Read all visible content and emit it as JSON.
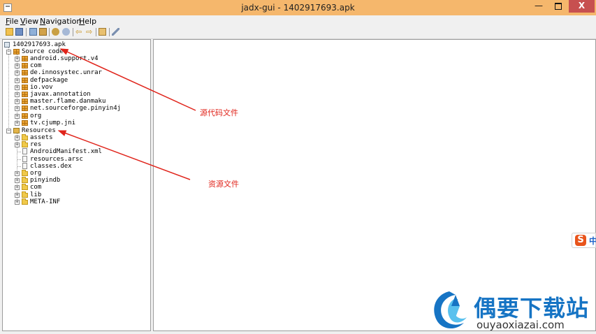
{
  "window": {
    "title": "jadx-gui - 1402917693.apk",
    "minimize_glyph": "—",
    "close_glyph": "X"
  },
  "menu": [
    "File",
    "View",
    "Navigation",
    "Help"
  ],
  "toolbar": {
    "icons": [
      "open-file-icon",
      "save-all-icon",
      "sync-tree-icon",
      "flatten-packages-icon",
      "search-text-icon",
      "search-class-icon",
      "back-icon",
      "forward-icon",
      "log-icon",
      "preferences-icon"
    ]
  },
  "tree": {
    "root": "1402917693.apk",
    "source_code": {
      "label": "Source code",
      "packages": [
        "android.support.v4",
        "com",
        "de.innosystec.unrar",
        "defpackage",
        "io.vov",
        "javax.annotation",
        "master.flame.danmaku",
        "net.sourceforge.pinyin4j",
        "org",
        "tv.cjump.jni"
      ]
    },
    "resources": {
      "label": "Resources",
      "items": [
        {
          "label": "assets",
          "type": "folder",
          "expandable": true
        },
        {
          "label": "res",
          "type": "folder",
          "expandable": true
        },
        {
          "label": "AndroidManifest.xml",
          "type": "file",
          "expandable": false
        },
        {
          "label": "resources.arsc",
          "type": "file",
          "expandable": false
        },
        {
          "label": "classes.dex",
          "type": "file",
          "expandable": false
        },
        {
          "label": "org",
          "type": "folder",
          "expandable": true
        },
        {
          "label": "pinyindb",
          "type": "folder",
          "expandable": true
        },
        {
          "label": "com",
          "type": "folder",
          "expandable": true
        },
        {
          "label": "lib",
          "type": "folder",
          "expandable": true
        },
        {
          "label": "META-INF",
          "type": "folder",
          "expandable": true
        }
      ]
    }
  },
  "annotations": {
    "source_label": "源代码文件",
    "resource_label": "资源文件",
    "color": "#e0241b"
  },
  "ime": {
    "s": "S",
    "zh": "中"
  },
  "watermark": {
    "cn": "偶要下载站",
    "url": "ouyaoxiazai.com"
  },
  "colors": {
    "titlebar": "#f5b76c",
    "close": "#c75050",
    "package": "#e9a234",
    "folder": "#f0c94a",
    "watermark_blue": "#1674c4"
  }
}
